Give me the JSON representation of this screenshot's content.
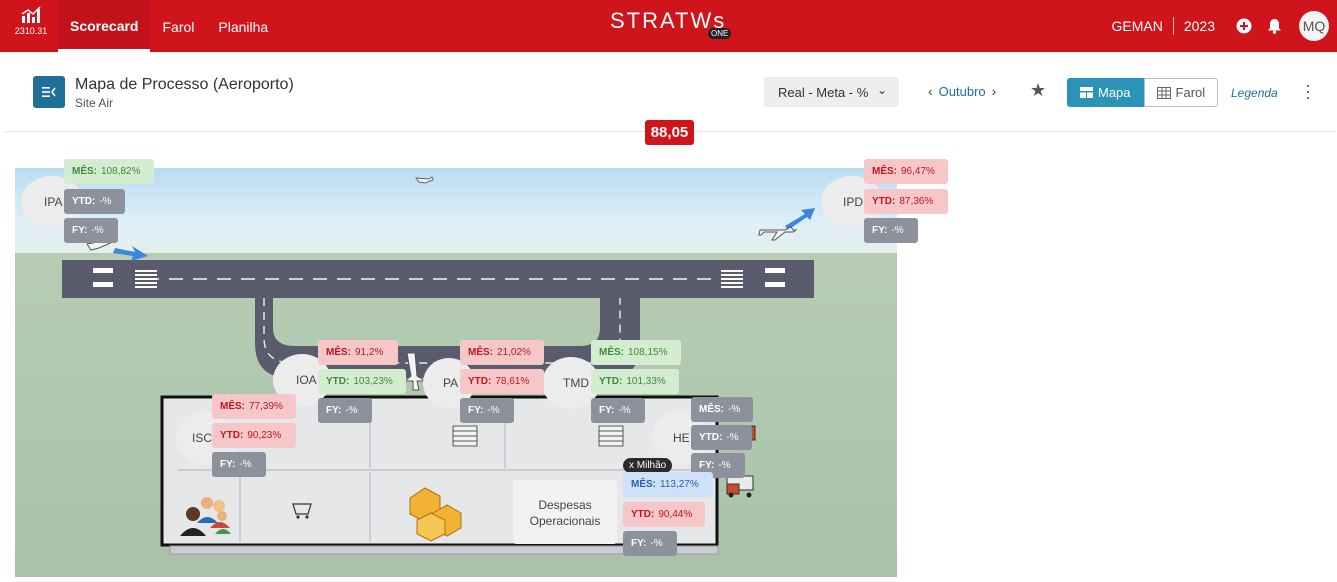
{
  "topbar": {
    "version": "2310.31",
    "nav": [
      "Scorecard",
      "Farol",
      "Planilha"
    ],
    "brand": "STRATWs",
    "brand_suffix": "ONE",
    "org": "GEMAN",
    "year": "2023",
    "user_initials": "MQ",
    "color": "#d0141c"
  },
  "header": {
    "title": "Mapa de Processo (Aeroporto)",
    "subtitle": "Site Air",
    "select_value": "Real - Meta - %",
    "period": "Outubro",
    "view_map": "Mapa",
    "view_farol": "Farol",
    "legend": "Legenda",
    "score": "88,05"
  },
  "nodes": {
    "ipa": "IPA",
    "ipd": "IPD",
    "ioa": "IOA",
    "pa": "PA",
    "tmd": "TMD",
    "isc": "ISC",
    "he": "HE"
  },
  "kpis": {
    "ipa_mes": "108,82%",
    "ipa_ytd": "-%",
    "ipa_fy": "-%",
    "ipd_mes": "96,47%",
    "ipd_ytd": "87,36%",
    "ipd_fy": "-%",
    "ioa_mes": "91,2%",
    "ioa_ytd": "103,23%",
    "ioa_fy": "-%",
    "pa_mes": "21,02%",
    "pa_ytd": "78,61%",
    "pa_fy": "-%",
    "tmd_mes": "108,15%",
    "tmd_ytd": "101,33%",
    "tmd_fy": "-%",
    "isc_mes": "77,39%",
    "isc_ytd": "90,23%",
    "isc_fy": "-%",
    "he_mes": "-%",
    "he_ytd": "-%",
    "he_fy": "-%",
    "desp_mes": "113,27%",
    "desp_ytd": "90,44%",
    "desp_fy": "-%"
  },
  "labels": {
    "mes": "MÊS:",
    "ytd": "YTD:",
    "fy": "FY:",
    "unit_tag": "x Milhão",
    "despesas": "Despesas Operacionais"
  }
}
